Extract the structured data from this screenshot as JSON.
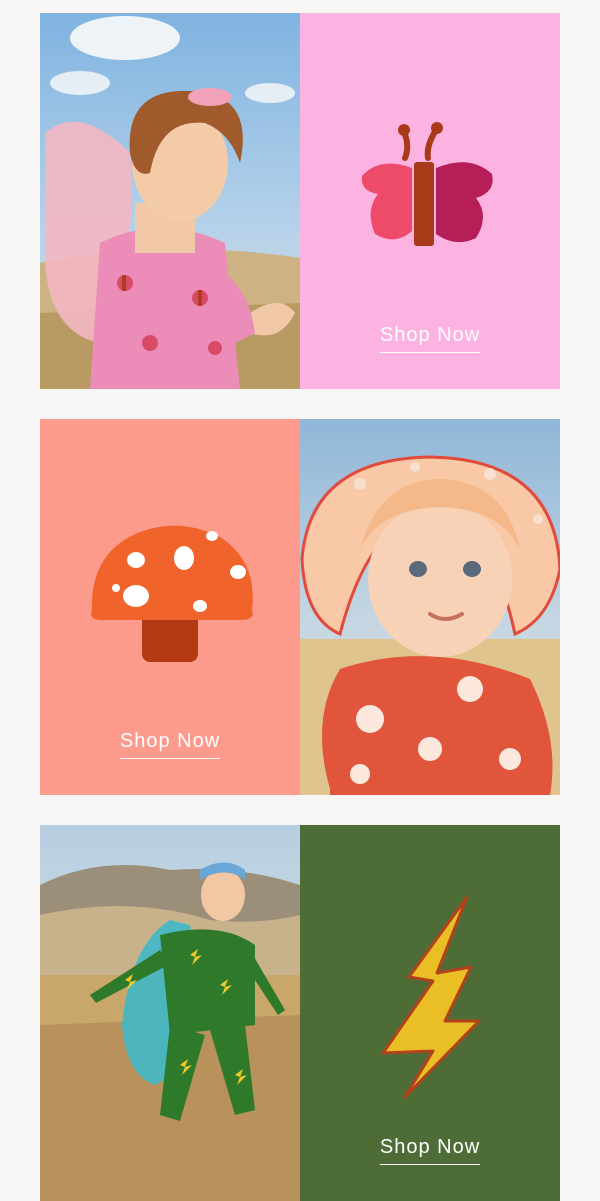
{
  "blocks": [
    {
      "cta": "Shop Now",
      "panel_color": "#fdb3e2",
      "icon": "butterfly-icon"
    },
    {
      "cta": "Shop Now",
      "panel_color": "#fc9a8c",
      "icon": "mushroom-icon"
    },
    {
      "cta": "Shop Now",
      "panel_color": "#4e6d36",
      "icon": "lightning-bolt-icon"
    }
  ]
}
